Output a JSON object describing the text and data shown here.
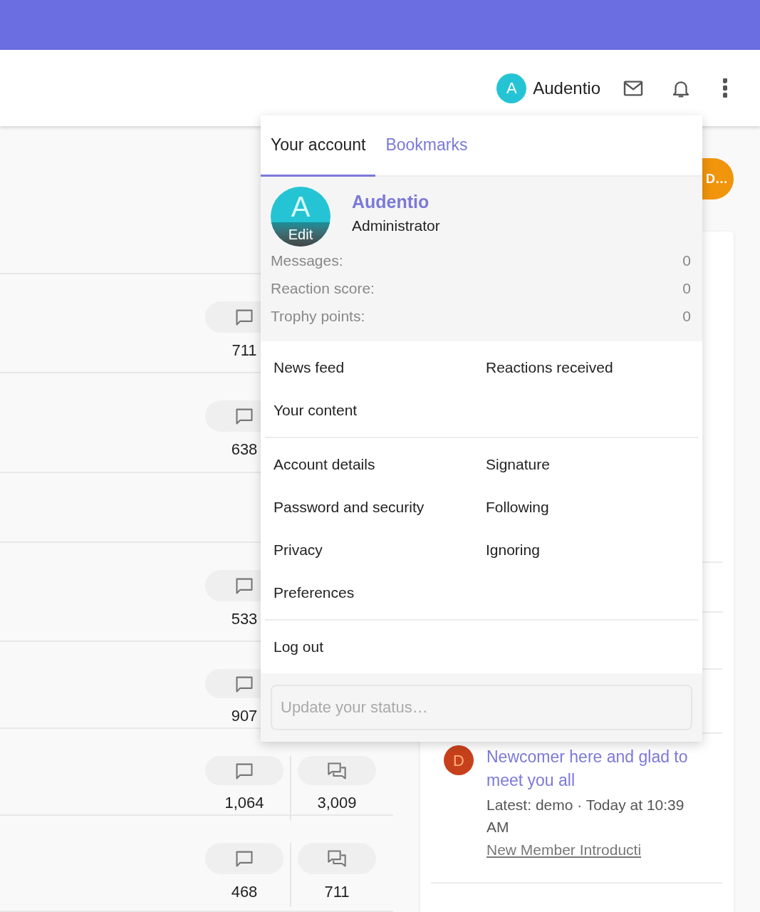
{
  "header": {
    "user": {
      "initial": "A",
      "name": "Audentio"
    }
  },
  "topic_rows": [
    {
      "kind": "stats",
      "stats": [
        {
          "kind": "messages",
          "value": "711"
        }
      ]
    },
    {
      "kind": "stats",
      "stats": [
        {
          "kind": "messages",
          "value": "638"
        }
      ]
    },
    {
      "kind": "plain"
    },
    {
      "kind": "stats",
      "stats": [
        {
          "kind": "messages",
          "value": "533"
        }
      ]
    },
    {
      "kind": "stats",
      "stats": [
        {
          "kind": "messages",
          "value": "907"
        }
      ]
    },
    {
      "kind": "stats",
      "stats": [
        {
          "kind": "messages",
          "value": "1,064"
        },
        {
          "kind": "threads",
          "value": "3,009"
        }
      ]
    },
    {
      "kind": "stats",
      "stats": [
        {
          "kind": "messages",
          "value": "468"
        },
        {
          "kind": "threads",
          "value": "711"
        }
      ]
    }
  ],
  "sidebar": {
    "badge": "D…",
    "latest_post": {
      "initial": "D",
      "title": "Newcomer here and glad to meet you all",
      "meta": "Latest: demo · Today at 10:39 AM",
      "forum": "New Member Introducti"
    }
  },
  "account_menu": {
    "tabs": [
      {
        "label": "Your account",
        "selected": true
      },
      {
        "label": "Bookmarks",
        "selected": false
      }
    ],
    "profile": {
      "initial": "A",
      "avatar_caption": "Edit",
      "name": "Audentio",
      "role": "Administrator"
    },
    "stats": [
      {
        "label": "Messages:",
        "value": "0"
      },
      {
        "label": "Reaction score:",
        "value": "0"
      },
      {
        "label": "Trophy points:",
        "value": "0"
      }
    ],
    "link_groups": [
      [
        "News feed",
        "Reactions received",
        "Your content"
      ],
      [
        "Account details",
        "Signature",
        "Password and security",
        "Following",
        "Privacy",
        "Ignoring",
        "Preferences"
      ],
      [
        "Log out"
      ]
    ],
    "status_field": {
      "placeholder": "Update your status…"
    }
  }
}
